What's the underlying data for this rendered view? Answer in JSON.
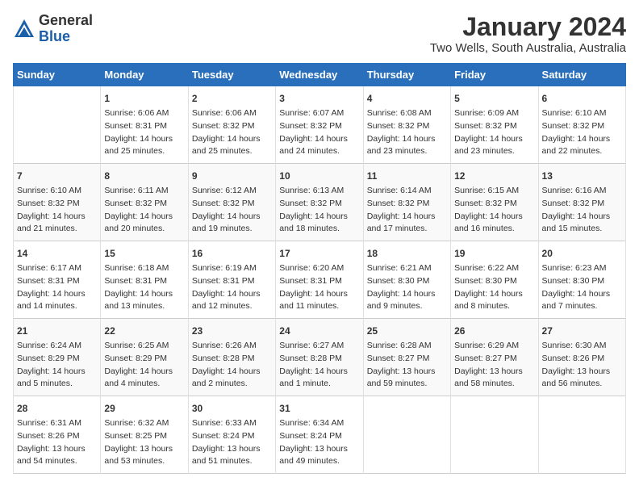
{
  "header": {
    "logo_general": "General",
    "logo_blue": "Blue",
    "title": "January 2024",
    "subtitle": "Two Wells, South Australia, Australia"
  },
  "calendar": {
    "weekdays": [
      "Sunday",
      "Monday",
      "Tuesday",
      "Wednesday",
      "Thursday",
      "Friday",
      "Saturday"
    ],
    "rows": [
      [
        {
          "day": "",
          "content": ""
        },
        {
          "day": "1",
          "content": "Sunrise: 6:06 AM\nSunset: 8:31 PM\nDaylight: 14 hours\nand 25 minutes."
        },
        {
          "day": "2",
          "content": "Sunrise: 6:06 AM\nSunset: 8:32 PM\nDaylight: 14 hours\nand 25 minutes."
        },
        {
          "day": "3",
          "content": "Sunrise: 6:07 AM\nSunset: 8:32 PM\nDaylight: 14 hours\nand 24 minutes."
        },
        {
          "day": "4",
          "content": "Sunrise: 6:08 AM\nSunset: 8:32 PM\nDaylight: 14 hours\nand 23 minutes."
        },
        {
          "day": "5",
          "content": "Sunrise: 6:09 AM\nSunset: 8:32 PM\nDaylight: 14 hours\nand 23 minutes."
        },
        {
          "day": "6",
          "content": "Sunrise: 6:10 AM\nSunset: 8:32 PM\nDaylight: 14 hours\nand 22 minutes."
        }
      ],
      [
        {
          "day": "7",
          "content": "Sunrise: 6:10 AM\nSunset: 8:32 PM\nDaylight: 14 hours\nand 21 minutes."
        },
        {
          "day": "8",
          "content": "Sunrise: 6:11 AM\nSunset: 8:32 PM\nDaylight: 14 hours\nand 20 minutes."
        },
        {
          "day": "9",
          "content": "Sunrise: 6:12 AM\nSunset: 8:32 PM\nDaylight: 14 hours\nand 19 minutes."
        },
        {
          "day": "10",
          "content": "Sunrise: 6:13 AM\nSunset: 8:32 PM\nDaylight: 14 hours\nand 18 minutes."
        },
        {
          "day": "11",
          "content": "Sunrise: 6:14 AM\nSunset: 8:32 PM\nDaylight: 14 hours\nand 17 minutes."
        },
        {
          "day": "12",
          "content": "Sunrise: 6:15 AM\nSunset: 8:32 PM\nDaylight: 14 hours\nand 16 minutes."
        },
        {
          "day": "13",
          "content": "Sunrise: 6:16 AM\nSunset: 8:32 PM\nDaylight: 14 hours\nand 15 minutes."
        }
      ],
      [
        {
          "day": "14",
          "content": "Sunrise: 6:17 AM\nSunset: 8:31 PM\nDaylight: 14 hours\nand 14 minutes."
        },
        {
          "day": "15",
          "content": "Sunrise: 6:18 AM\nSunset: 8:31 PM\nDaylight: 14 hours\nand 13 minutes."
        },
        {
          "day": "16",
          "content": "Sunrise: 6:19 AM\nSunset: 8:31 PM\nDaylight: 14 hours\nand 12 minutes."
        },
        {
          "day": "17",
          "content": "Sunrise: 6:20 AM\nSunset: 8:31 PM\nDaylight: 14 hours\nand 11 minutes."
        },
        {
          "day": "18",
          "content": "Sunrise: 6:21 AM\nSunset: 8:30 PM\nDaylight: 14 hours\nand 9 minutes."
        },
        {
          "day": "19",
          "content": "Sunrise: 6:22 AM\nSunset: 8:30 PM\nDaylight: 14 hours\nand 8 minutes."
        },
        {
          "day": "20",
          "content": "Sunrise: 6:23 AM\nSunset: 8:30 PM\nDaylight: 14 hours\nand 7 minutes."
        }
      ],
      [
        {
          "day": "21",
          "content": "Sunrise: 6:24 AM\nSunset: 8:29 PM\nDaylight: 14 hours\nand 5 minutes."
        },
        {
          "day": "22",
          "content": "Sunrise: 6:25 AM\nSunset: 8:29 PM\nDaylight: 14 hours\nand 4 minutes."
        },
        {
          "day": "23",
          "content": "Sunrise: 6:26 AM\nSunset: 8:28 PM\nDaylight: 14 hours\nand 2 minutes."
        },
        {
          "day": "24",
          "content": "Sunrise: 6:27 AM\nSunset: 8:28 PM\nDaylight: 14 hours\nand 1 minute."
        },
        {
          "day": "25",
          "content": "Sunrise: 6:28 AM\nSunset: 8:27 PM\nDaylight: 13 hours\nand 59 minutes."
        },
        {
          "day": "26",
          "content": "Sunrise: 6:29 AM\nSunset: 8:27 PM\nDaylight: 13 hours\nand 58 minutes."
        },
        {
          "day": "27",
          "content": "Sunrise: 6:30 AM\nSunset: 8:26 PM\nDaylight: 13 hours\nand 56 minutes."
        }
      ],
      [
        {
          "day": "28",
          "content": "Sunrise: 6:31 AM\nSunset: 8:26 PM\nDaylight: 13 hours\nand 54 minutes."
        },
        {
          "day": "29",
          "content": "Sunrise: 6:32 AM\nSunset: 8:25 PM\nDaylight: 13 hours\nand 53 minutes."
        },
        {
          "day": "30",
          "content": "Sunrise: 6:33 AM\nSunset: 8:24 PM\nDaylight: 13 hours\nand 51 minutes."
        },
        {
          "day": "31",
          "content": "Sunrise: 6:34 AM\nSunset: 8:24 PM\nDaylight: 13 hours\nand 49 minutes."
        },
        {
          "day": "",
          "content": ""
        },
        {
          "day": "",
          "content": ""
        },
        {
          "day": "",
          "content": ""
        }
      ]
    ]
  }
}
